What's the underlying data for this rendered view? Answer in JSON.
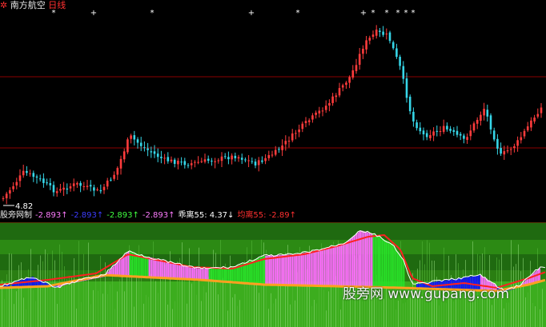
{
  "header": {
    "stock_name": "南方航空",
    "period": "日线",
    "colors": {
      "icon": "#ff3030",
      "name": "#e8e8e8",
      "period": "#ff3030"
    }
  },
  "price_chart": {
    "low_label": "4.82",
    "colors": {
      "up": "#ff3c3c",
      "down": "#36d6e8",
      "grid": "#8b0000",
      "marker": "#ffffff"
    }
  },
  "indicator": {
    "items": [
      {
        "label": "股旁网制",
        "color": "#e8e8e8"
      },
      {
        "label": "-2.893↑",
        "color": "#ff7cff"
      },
      {
        "label": "-2.893↑",
        "color": "#3c3cff"
      },
      {
        "label": "-2.893↑",
        "color": "#40ff40"
      },
      {
        "label": "-2.893↑",
        "color": "#ff7cff"
      },
      {
        "label": "乖离55: 4.37↓",
        "color": "#ffffff"
      },
      {
        "label": "均离55: -2.89↑",
        "color": "#ff3030"
      }
    ],
    "colors": {
      "bg_dark": "#1f6a10",
      "bg_light": "#3cad1e",
      "magenta": "#ff6cff",
      "green": "#28e028",
      "blue": "#1010ff",
      "white_line": "#ffffff",
      "red_line": "#ff2020",
      "orange_line": "#ffa020"
    }
  },
  "watermark": {
    "text": "股旁网  www.gupang.com"
  }
}
